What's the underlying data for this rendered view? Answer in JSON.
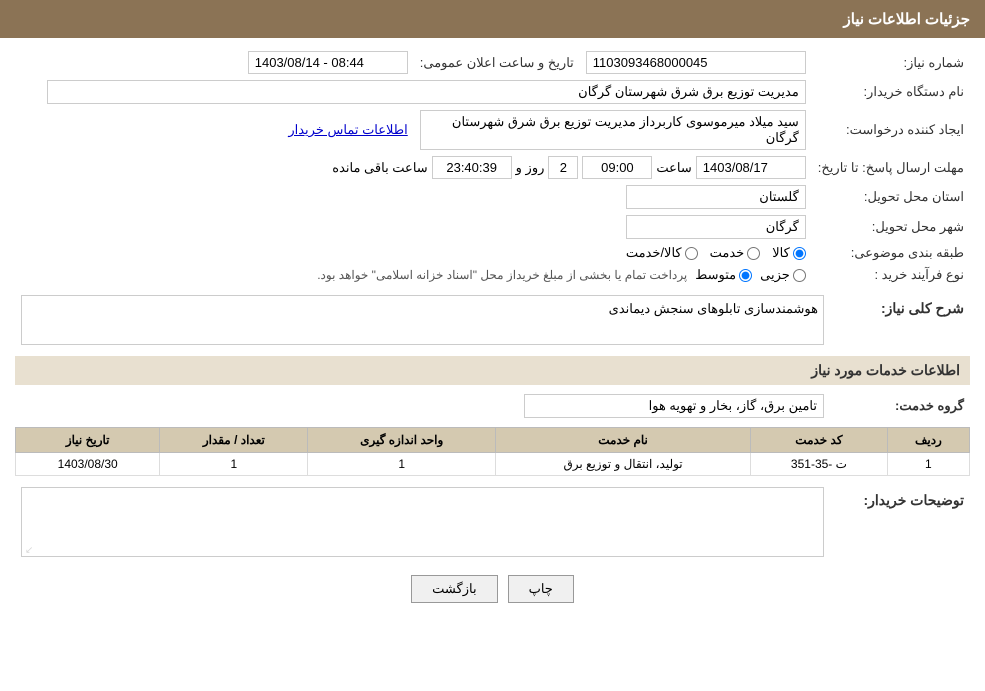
{
  "header": {
    "title": "جزئیات اطلاعات نیاز"
  },
  "fields": {
    "shomareNiaz_label": "شماره نیاز:",
    "shomareNiaz_value": "1103093468000045",
    "namDastgah_label": "نام دستگاه خریدار:",
    "namDastgah_value": "مدیریت توزیع برق شرق شهرستان گرگان",
    "tarikhAlan_label": "تاریخ و ساعت اعلان عمومی:",
    "tarikhAlan_value": "1403/08/14 - 08:44",
    "ijadKonande_label": "ایجاد کننده درخواست:",
    "ijadKonande_value": "سید میلاد میرموسوی کاربرداز مدیریت توزیع برق شرق شهرستان گرگان",
    "ettelaatTamas_label": "اطلاعات تماس خریدار",
    "mohlat_label": "مهلت ارسال پاسخ: تا تاریخ:",
    "mohlat_date": "1403/08/17",
    "mohlat_saat_label": "ساعت",
    "mohlat_saat": "09:00",
    "mohlat_roz_label": "روز و",
    "mohlat_roz": "2",
    "mohlat_baqi_label": "ساعت باقی مانده",
    "mohlat_baqi": "23:40:39",
    "ostan_label": "استان محل تحویل:",
    "ostan_value": "گلستان",
    "shahr_label": "شهر محل تحویل:",
    "shahr_value": "گرگان",
    "tabaqe_label": "طبقه بندی موضوعی:",
    "tabaqe_options": [
      "کالا",
      "خدمت",
      "کالا/خدمت"
    ],
    "tabaqe_selected": "کالا",
    "noeFarayand_label": "نوع فرآیند خرید :",
    "noeFarayand_options": [
      "جزیی",
      "متوسط"
    ],
    "noeFarayand_note": "پرداخت تمام یا بخشی از مبلغ خریداز محل \"اسناد خزانه اسلامی\" خواهد بود.",
    "sharhKoli_label": "شرح کلی نیاز:",
    "sharhKoli_value": "هوشمندسازی تابلوهای سنجش دیماندی",
    "khadamat_label": "اطلاعات خدمات مورد نیاز",
    "groheKhadamat_label": "گروه خدمت:",
    "groheKhadamat_value": "تامین برق، گاز، بخار و تهویه هوا",
    "table": {
      "headers": [
        "ردیف",
        "کد خدمت",
        "نام خدمت",
        "واحد اندازه گیری",
        "تعداد / مقدار",
        "تاریخ نیاز"
      ],
      "rows": [
        {
          "radif": "1",
          "kodKhadamat": "ت -35-351",
          "namKhadamat": "تولید، انتقال و توزیع برق",
          "vahed": "1",
          "tedad": "1",
          "tarikh": "1403/08/30"
        }
      ]
    },
    "tawzih_label": "توضیحات خریدار:",
    "tawzih_value": ""
  },
  "buttons": {
    "print_label": "چاپ",
    "back_label": "بازگشت"
  }
}
